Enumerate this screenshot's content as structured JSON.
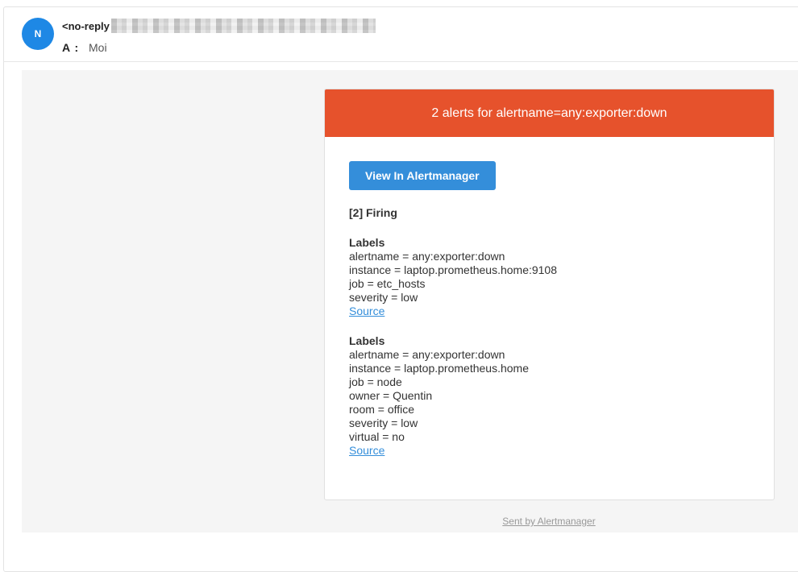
{
  "header": {
    "avatar_initial": "N",
    "sender": "<no-reply",
    "to_label": "A :",
    "to_value": "Moi"
  },
  "alert": {
    "title": "2 alerts for alertname=any:exporter:down",
    "button_label": "View In Alertmanager",
    "firing": "[2] Firing",
    "groups": [
      {
        "title": "Labels",
        "lines": [
          "alertname = any:exporter:down",
          "instance = laptop.prometheus.home:9108",
          "job = etc_hosts",
          "severity = low"
        ],
        "source_label": "Source"
      },
      {
        "title": "Labels",
        "lines": [
          "alertname = any:exporter:down",
          "instance = laptop.prometheus.home",
          "job = node",
          "owner = Quentin",
          "room = office",
          "severity = low",
          "virtual = no"
        ],
        "source_label": "Source"
      }
    ]
  },
  "footer": {
    "text": "Sent by Alertmanager"
  },
  "colors": {
    "header_bg": "#e6522c",
    "button_bg": "#348eda",
    "avatar_bg": "#1e88e5"
  }
}
